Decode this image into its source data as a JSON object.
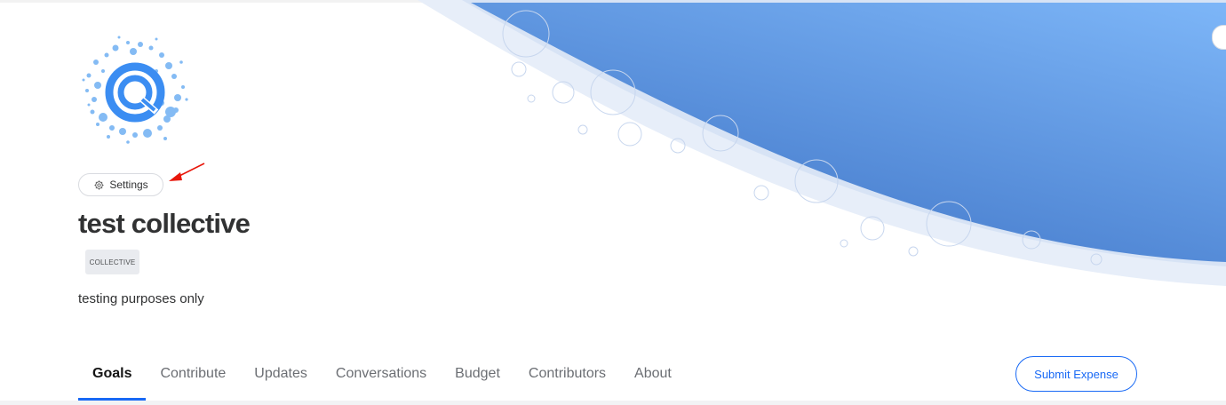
{
  "collective": {
    "name": "test collective",
    "type_badge": "COLLECTIVE",
    "description": "testing purposes only"
  },
  "settings": {
    "label": "Settings",
    "icon": "gear-icon"
  },
  "annotation": {
    "icon": "red-arrow",
    "color": "#e8170b"
  },
  "nav": {
    "items": [
      {
        "label": "Goals",
        "active": true
      },
      {
        "label": "Contribute"
      },
      {
        "label": "Updates"
      },
      {
        "label": "Conversations"
      },
      {
        "label": "Budget"
      },
      {
        "label": "Contributors"
      },
      {
        "label": "About"
      }
    ],
    "submit_label": "Submit Expense"
  },
  "colors": {
    "accent": "#1869f5",
    "hero_gradient_start": "#7db6f8",
    "hero_gradient_end": "#3f74c6"
  }
}
